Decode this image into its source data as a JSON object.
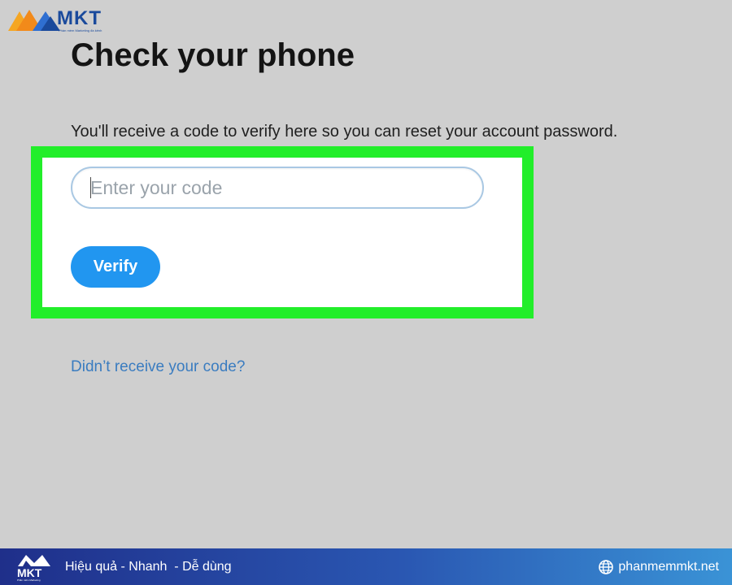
{
  "branding": {
    "logo_text": "MKT",
    "logo_tagline": "Phần mềm Marketing đa kênh"
  },
  "page": {
    "title": "Check your phone",
    "instructions": "You'll receive a code to verify here so you can reset your account password."
  },
  "form": {
    "code_placeholder": "Enter your code",
    "code_value": "",
    "verify_label": "Verify"
  },
  "resend": {
    "link_text": "Didn’t receive your code?"
  },
  "footer": {
    "logo_text": "MKT",
    "logo_tagline": "Phần mềm Marketing",
    "slogan": "Hiệu quả - Nhanh  - Dễ dùng",
    "site": "phanmemmkt.net"
  },
  "colors": {
    "highlight": "#22ee2a",
    "button": "#2196f0",
    "link": "#3a7cc0",
    "background": "#cfcfcf"
  },
  "icons": {
    "logo": "mkt-logo-icon",
    "footer_logo": "mkt-footer-logo-icon",
    "site": "globe-icon"
  }
}
